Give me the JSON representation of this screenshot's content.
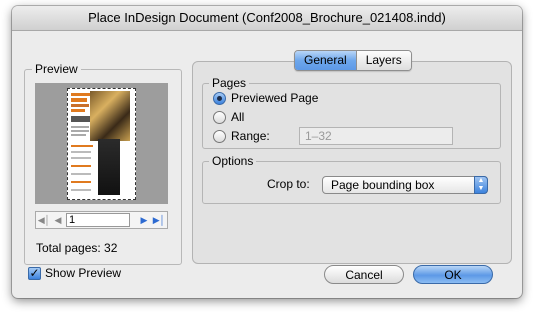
{
  "window": {
    "title": "Place InDesign Document (Conf2008_Brochure_021408.indd)"
  },
  "preview": {
    "legend": "Preview",
    "page_field_value": "1",
    "nav_icons": [
      "first-page-icon",
      "previous-page-icon",
      "next-page-icon",
      "last-page-icon"
    ],
    "total_pages": "Total pages: 32"
  },
  "tabs": [
    {
      "label": "General",
      "active": true
    },
    {
      "label": "Layers",
      "active": false
    }
  ],
  "pages": {
    "legend": "Pages",
    "options": [
      {
        "label": "Previewed Page",
        "checked": true
      },
      {
        "label": "All",
        "checked": false
      },
      {
        "label": "Range:",
        "checked": false
      }
    ],
    "range_value": "1–32"
  },
  "options": {
    "legend": "Options",
    "crop_label": "Crop to:",
    "crop_value": "Page bounding box"
  },
  "footer": {
    "show_preview_label": "Show Preview",
    "show_preview_checked": true,
    "cancel_label": "Cancel",
    "ok_label": "OK"
  },
  "colors": {
    "accent": "#5d99e6",
    "thumbnail_orange": "#e07a1f"
  }
}
